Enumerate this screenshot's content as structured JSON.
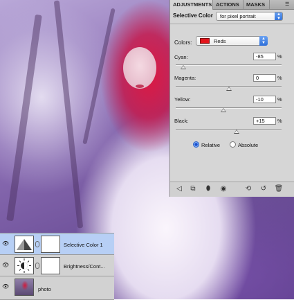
{
  "adjustments_panel": {
    "tabs": [
      "ADJUSTMENTS",
      "ACTIONS",
      "MASKS"
    ],
    "title": "Selective Color",
    "preset_value": "for pixel portrait",
    "colors_label": "Colors:",
    "colors_value": "Reds",
    "swatch_color": "#e4141b",
    "sliders": [
      {
        "label": "Cyan:",
        "value": "-85",
        "unit": "%",
        "level": -85
      },
      {
        "label": "Magenta:",
        "value": "0",
        "unit": "%",
        "level": 0
      },
      {
        "label": "Yellow:",
        "value": "-10",
        "unit": "%",
        "level": -10
      },
      {
        "label": "Black:",
        "value": "+15",
        "unit": "%",
        "level": 15
      }
    ],
    "method": {
      "relative_label": "Relative",
      "absolute_label": "Absolute",
      "selected": "Relative"
    },
    "toolbar_icons": [
      "back-arrow-icon",
      "panel-view-icon",
      "clip-layer-icon",
      "visibility-icon",
      "view-previous-icon",
      "reset-icon",
      "delete-icon"
    ]
  },
  "layers_panel": {
    "layers": [
      {
        "name": "Selective Color 1",
        "selected": true
      },
      {
        "name": "Brightness/Cont...",
        "selected": false
      },
      {
        "name": "photo",
        "selected": false
      }
    ]
  },
  "colors": {
    "accent": "#2e6fd9",
    "selection": "#b7cff5",
    "panel_bg": "#d6d6d6"
  }
}
